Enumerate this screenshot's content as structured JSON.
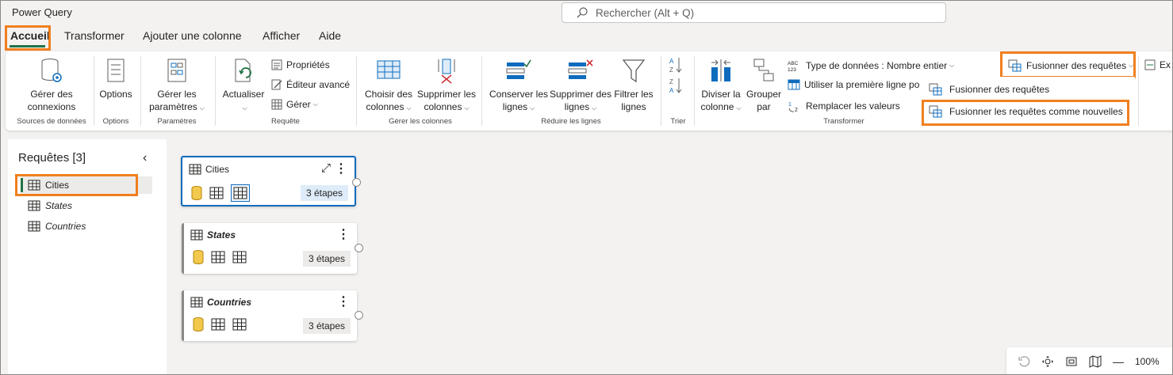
{
  "app": {
    "title": "Power Query"
  },
  "search": {
    "placeholder": "Rechercher (Alt + Q)"
  },
  "tabs": [
    {
      "label": "Accueil",
      "active": true
    },
    {
      "label": "Transformer"
    },
    {
      "label": "Ajouter une colonne"
    },
    {
      "label": "Afficher"
    },
    {
      "label": "Aide"
    }
  ],
  "ribbon": {
    "groups": {
      "sources": {
        "label": "Sources de données",
        "manage_connections": "Gérer des connexions"
      },
      "options": {
        "label": "Options",
        "options_button": "Options"
      },
      "parameters": {
        "label": "Paramètres",
        "manage_parameters": "Gérer les paramètres"
      },
      "query": {
        "label": "Requête",
        "refresh": "Actualiser",
        "properties": "Propriétés",
        "advanced_editor": "Éditeur avancé",
        "manage": "Gérer"
      },
      "columns": {
        "label": "Gérer les colonnes",
        "choose_columns": "Choisir des colonnes",
        "remove_columns": "Supprimer les colonnes"
      },
      "reduce_rows": {
        "label": "Réduire les lignes",
        "keep_rows": "Conserver les lignes",
        "remove_rows": "Supprimer des lignes",
        "filter_rows": "Filtrer les lignes"
      },
      "sort": {
        "label": "Trier"
      },
      "transform": {
        "label": "Transformer",
        "split_column": "Diviser la colonne",
        "group_by": "Grouper par",
        "data_type": "Type de données : Nombre entier",
        "first_row_headers": "Utiliser la première ligne po",
        "replace_values": "Remplacer les valeurs"
      },
      "combine": {
        "merge_queries": "Fusionner des requêtes",
        "overflow_label": "Ex"
      }
    }
  },
  "merge_dropdown": {
    "items": [
      {
        "label": "Fusionner des requêtes"
      },
      {
        "label": "Fusionner les requêtes comme nouvelles"
      }
    ]
  },
  "queries_pane": {
    "title": "Requêtes [3]",
    "items": [
      {
        "label": "Cities",
        "selected": true
      },
      {
        "label": "States"
      },
      {
        "label": "Countries"
      }
    ]
  },
  "diagram": {
    "cards": [
      {
        "name": "Cities",
        "steps": "3 étapes",
        "selected": true
      },
      {
        "name": "States",
        "steps": "3 étapes"
      },
      {
        "name": "Countries",
        "steps": "3 étapes"
      }
    ]
  },
  "statusbar": {
    "zoom": "100%"
  },
  "colors": {
    "accent_green": "#217346",
    "highlight_orange": "#f07f1e",
    "selection_blue": "#0f6cbd"
  }
}
